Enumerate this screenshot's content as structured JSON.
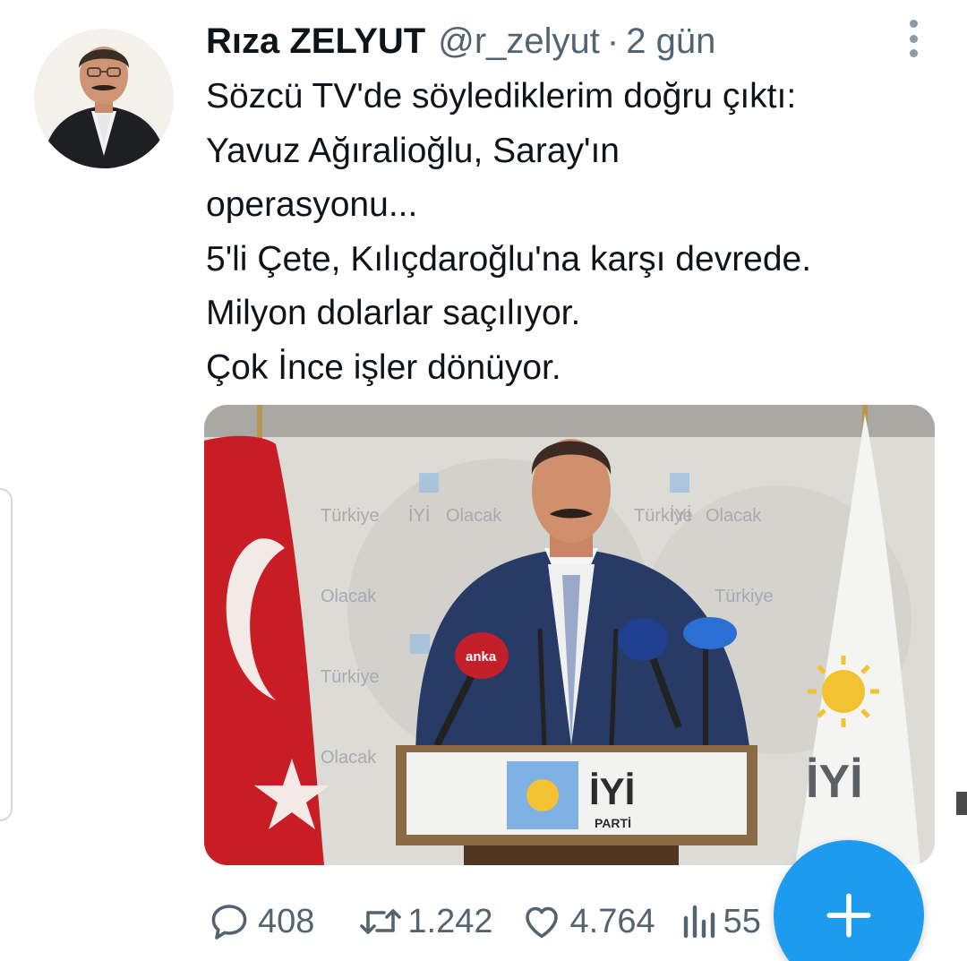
{
  "tweet": {
    "author_name": "Rıza ZELYUT",
    "handle": "@r_zelyut",
    "separator": "·",
    "time": "2 gün",
    "text_lines": [
      "Sözcü TV'de söylediklerim doğru çıktı:",
      "Yavuz Ağıralioğlu, Saray'ın",
      "operasyonu...",
      "5'li Çete, Kılıçdaroğlu'na karşı devrede.",
      "Milyon dolarlar saçılıyor.",
      "Çok İnce işler dönüyor."
    ],
    "media": {
      "description_visible_text": {
        "backdrop_word_1": "Türkiye",
        "backdrop_word_2": "İYİ",
        "backdrop_word_3": "Olacak",
        "podium_logo": "İYİ",
        "podium_sub": "PARTİ",
        "mic_label": "anka",
        "flag_logo": "İYİ"
      }
    },
    "actions": {
      "replies": "408",
      "retweets": "1.242",
      "likes": "4.764",
      "views": "55"
    }
  },
  "icons": {
    "reply": "speech-bubble-icon",
    "retweet": "retweet-arrows-icon",
    "like": "heart-icon",
    "views": "bar-chart-icon",
    "more": "vertical-ellipsis-icon",
    "compose": "plus-icon"
  },
  "colors": {
    "text_primary": "#0f1419",
    "text_secondary": "#536471",
    "accent": "#1d9bf0"
  }
}
